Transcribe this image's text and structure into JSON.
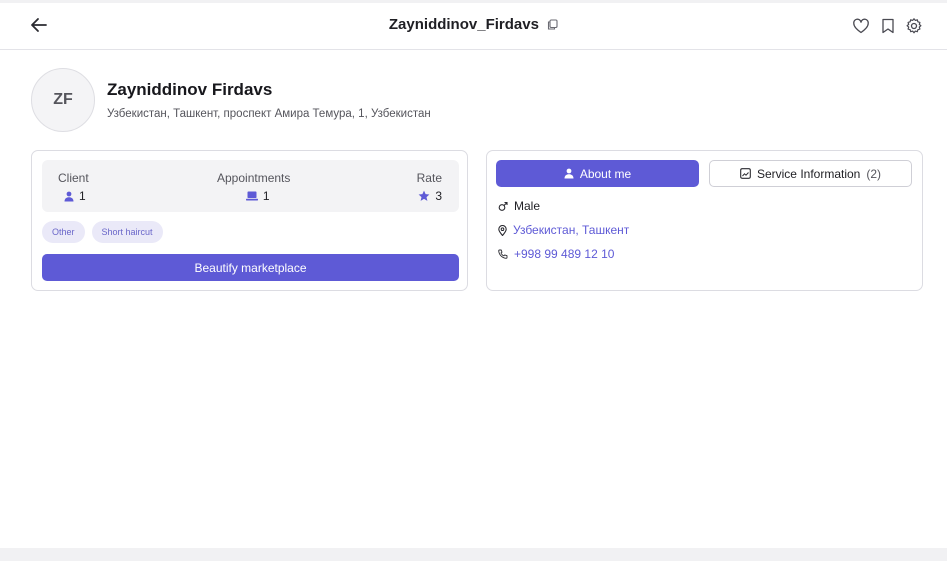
{
  "header": {
    "title": "Zayniddinov_Firdavs"
  },
  "profile": {
    "initials": "ZF",
    "name": "Zayniddinov Firdavs",
    "address": "Узбекистан, Ташкент, проспект Амира Темура, 1, Узбекистан"
  },
  "stats": {
    "client_label": "Client",
    "client_value": "1",
    "appointments_label": "Appointments",
    "appointments_value": "1",
    "rate_label": "Rate",
    "rate_value": "3"
  },
  "tags": [
    "Other",
    "Short haircut"
  ],
  "marketplace_button": "Beautify marketplace",
  "tabs": {
    "about_label": "About me",
    "service_label": "Service Information",
    "service_count": "(2)"
  },
  "info": {
    "gender": "Male",
    "location": "Узбекистан, Ташкент",
    "phone": "+998 99 489 12 10"
  },
  "colors": {
    "accent": "#5e5ad6",
    "tag_bg": "#eae9f8",
    "stats_bg": "#f3f3f5"
  },
  "icons": {
    "back": "arrow-left-icon",
    "copy": "copy-icon",
    "favorite": "heart-icon",
    "bookmark": "bookmark-icon",
    "settings": "gear-icon"
  }
}
